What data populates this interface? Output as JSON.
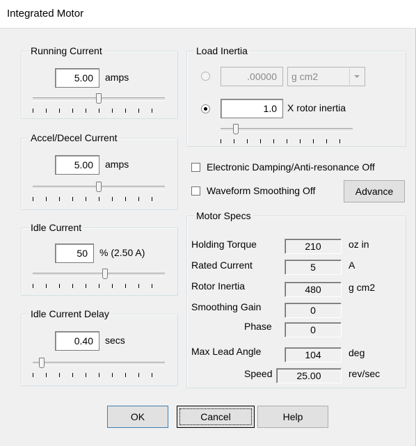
{
  "window": {
    "title": "Integrated Motor"
  },
  "running_current": {
    "legend": "Running Current",
    "value": "5.00",
    "unit": "amps",
    "slider_level": 0.5
  },
  "accel_decel_current": {
    "legend": "Accel/Decel Current",
    "value": "5.00",
    "unit": "amps",
    "slider_level": 0.5
  },
  "idle_current": {
    "legend": "Idle Current",
    "value": "50",
    "unit": "% (2.50 A)",
    "slider_level": 0.55
  },
  "idle_current_delay": {
    "legend": "Idle Current Delay",
    "value": "0.40",
    "unit": "secs",
    "slider_level": 0.05
  },
  "load_inertia": {
    "legend": "Load Inertia",
    "absolute_value": ".00000",
    "unit_selected": "g cm2",
    "ratio_value": "1.0",
    "ratio_label": "X rotor inertia",
    "selected_option": "ratio",
    "slider_level": 0.1
  },
  "options": {
    "damping_label": "Electronic Damping/Anti-resonance Off",
    "damping_checked": false,
    "smoothing_label": "Waveform Smoothing Off",
    "smoothing_checked": false,
    "advance_label": "Advance"
  },
  "motor_specs": {
    "legend": "Motor Specs",
    "rows": [
      {
        "label": "Holding Torque",
        "value": "210",
        "unit": "oz in"
      },
      {
        "label": "Rated Current",
        "value": "5",
        "unit": "A"
      },
      {
        "label": "Rotor Inertia",
        "value": "480",
        "unit": "g cm2"
      },
      {
        "label": "Smoothing Gain",
        "value": "0",
        "unit": ""
      },
      {
        "label": "Phase",
        "value": "0",
        "unit": ""
      },
      {
        "label": "Max Lead Angle",
        "value": "104",
        "unit": "deg"
      },
      {
        "label": "Speed",
        "value": "25.00",
        "unit": "rev/sec"
      }
    ]
  },
  "buttons": {
    "ok": "OK",
    "cancel": "Cancel",
    "help": "Help"
  },
  "colors": {
    "window_bg": "#f0f0f0",
    "group_border": "#d5dfe5",
    "default_button_border": "#3c7fb1"
  }
}
